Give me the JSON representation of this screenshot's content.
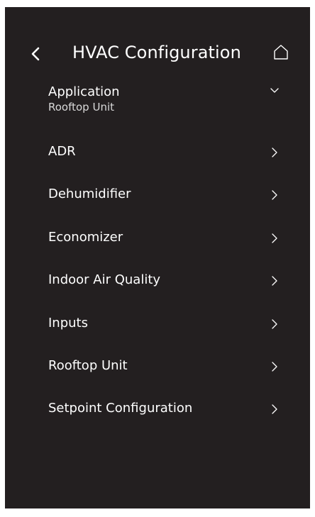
{
  "header": {
    "back_icon": "chevron-left-icon",
    "title": "HVAC Configuration",
    "home_icon": "home-icon"
  },
  "menu": {
    "items": [
      {
        "label": "Application",
        "value": "Rooftop Unit",
        "icon": "chevron-down-icon"
      },
      {
        "label": "ADR",
        "icon": "chevron-right-icon"
      },
      {
        "label": "Dehumidifier",
        "icon": "chevron-right-icon"
      },
      {
        "label": "Economizer",
        "icon": "chevron-right-icon"
      },
      {
        "label": "Indoor Air Quality",
        "icon": "chevron-right-icon"
      },
      {
        "label": "Inputs",
        "icon": "chevron-right-icon"
      },
      {
        "label": "Rooftop Unit",
        "icon": "chevron-right-icon"
      },
      {
        "label": "Setpoint Configuration",
        "icon": "chevron-right-icon"
      }
    ]
  },
  "colors": {
    "background": "#231f20",
    "text": "#ffffff",
    "subtext": "#d9d9d9"
  }
}
